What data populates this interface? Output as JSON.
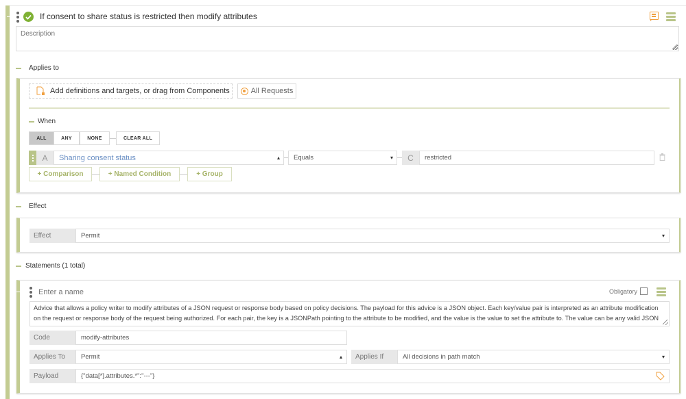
{
  "rule": {
    "title": "If consent to share status is restricted then modify attributes",
    "description_placeholder": "Description",
    "status_icon": "check-circle-icon",
    "comment_icon": "comment-icon",
    "menu_icon": "hamburger-menu-icon"
  },
  "applies_to": {
    "section_label": "Applies to",
    "add_definitions_label": "Add definitions and targets, or drag from Components",
    "all_requests_label": "All Requests"
  },
  "when": {
    "section_label": "When",
    "match_modes": [
      {
        "label": "ALL",
        "active": true
      },
      {
        "label": "ANY",
        "active": false
      },
      {
        "label": "NONE",
        "active": false
      }
    ],
    "clear_all_label": "CLEAR ALL",
    "condition": {
      "left_tag": "A",
      "attribute": "Sharing consent status",
      "operator": "Equals",
      "right_tag": "C",
      "value": "restricted"
    },
    "add_comparison_label": "+ Comparison",
    "add_named_condition_label": "+ Named Condition",
    "add_group_label": "+ Group"
  },
  "effect": {
    "section_label": "Effect",
    "field_label": "Effect",
    "value": "Permit"
  },
  "statements": {
    "section_label": "Statements (1 total)",
    "items": [
      {
        "name_placeholder": "Enter a name",
        "obligatory_label": "Obligatory",
        "obligatory_checked": false,
        "description": "Advice that allows a policy writer to modify attributes of a JSON request or response body based on policy decisions. The payload for this advice is a JSON object. Each key/value pair is interpreted as an attribute modification on the request or response body of the request being authorized. For each pair, the key is a JSONPath pointing to the attribute to be modified, and the value is the value to set the attribute to. The value can be any valid JSON",
        "code_label": "Code",
        "code_value": "modify-attributes",
        "applies_to_label": "Applies To",
        "applies_to_value": "Permit",
        "applies_if_label": "Applies If",
        "applies_if_value": "All decisions in path match",
        "payload_label": "Payload",
        "payload_value": "{\"data[*].attributes.*\":\"---\"}"
      }
    ]
  },
  "colors": {
    "accent_green": "#c3cc92",
    "check_green": "#7fb134",
    "orange": "#f0a040",
    "link_blue": "#6a8fc4"
  }
}
